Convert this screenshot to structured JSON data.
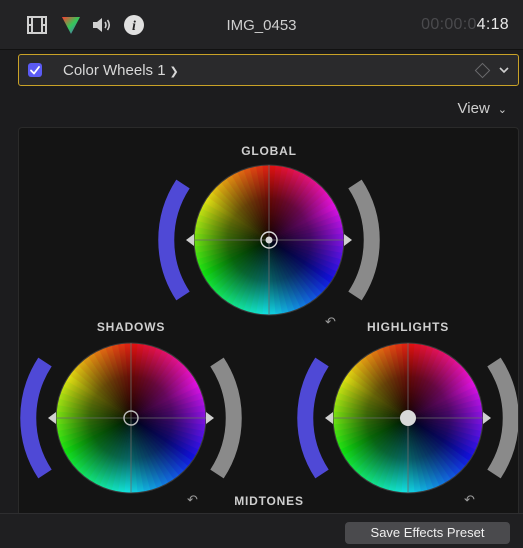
{
  "header": {
    "clip_name": "IMG_0453",
    "timecode_dim": "00:00:0",
    "timecode_lit": "4:18",
    "icons": [
      "video-inspector-icon",
      "color-inspector-icon",
      "audio-inspector-icon",
      "info-inspector-icon"
    ]
  },
  "effect": {
    "enabled": true,
    "name": "Color Wheels 1",
    "accent": "#c9a227",
    "checkbox_color": "#5b5bf5"
  },
  "view_menu": {
    "label": "View"
  },
  "wheels": {
    "global": {
      "label": "GLOBAL"
    },
    "shadows": {
      "label": "SHADOWS"
    },
    "midtones": {
      "label": "MIDTONES"
    },
    "highlights": {
      "label": "HIGHLIGHTS"
    }
  },
  "footer": {
    "save_preset_label": "Save Effects Preset"
  }
}
